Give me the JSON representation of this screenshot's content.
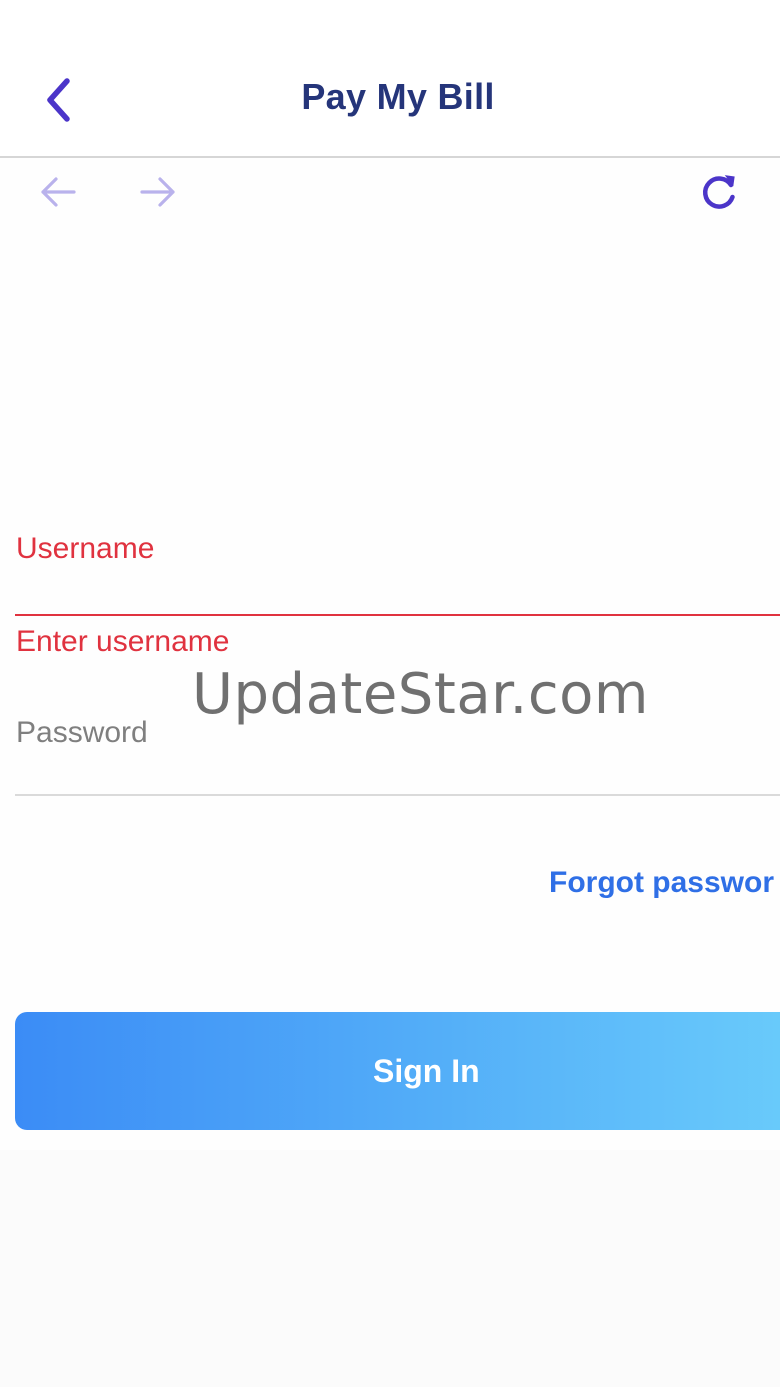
{
  "header": {
    "title": "Pay My Bill",
    "back_icon": "chevron-left-icon"
  },
  "webnav": {
    "back_icon": "arrow-left-icon",
    "forward_icon": "arrow-right-icon",
    "reload_icon": "refresh-icon"
  },
  "form": {
    "username": {
      "label": "Username",
      "value": "",
      "error": "Enter username"
    },
    "password": {
      "placeholder": "Password",
      "value": ""
    },
    "forgot_label": "Forgot passwor",
    "signin_label": "Sign In"
  },
  "watermark": "UpdateStar.com",
  "colors": {
    "accent": "#4b35c9",
    "title": "#25357a",
    "error": "#e0323f",
    "link": "#2f6fe6",
    "button_start": "#3b8cf6",
    "button_end": "#6accfb",
    "nav_disabled": "#b9b2ec"
  }
}
